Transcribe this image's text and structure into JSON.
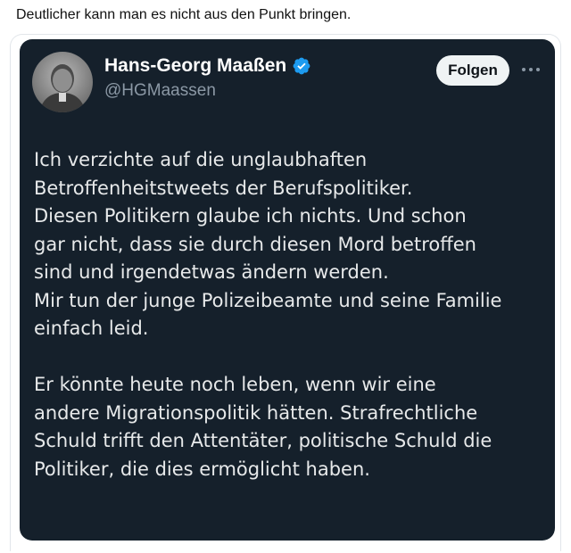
{
  "caption": "Deutlicher kann man es nicht aus den Punkt bringen.",
  "tweet": {
    "author_name": "Hans-Georg Maaßen",
    "handle": "@HGMaassen",
    "verified_icon": "verified-badge-icon",
    "follow_label": "Folgen",
    "more_icon": "more-dots-icon",
    "accent_color": "#1d9bf0",
    "background_color": "#15202b",
    "lines": [
      "Ich verzichte auf die unglaubhaften",
      "Betroffenheitstweets der Berufspolitiker.",
      "Diesen Politikern glaube ich nichts. Und schon",
      "gar nicht, dass sie durch diesen Mord betroffen",
      "sind und irgendetwas ändern werden.",
      "Mir tun der junge Polizeibeamte und seine Familie",
      "einfach leid.",
      "",
      "Er könnte heute noch leben, wenn wir eine",
      "andere Migrationspolitik hätten. Strafrechtliche",
      "Schuld trifft den Attentäter, politische Schuld die",
      "Politiker, die dies ermöglicht haben."
    ]
  }
}
